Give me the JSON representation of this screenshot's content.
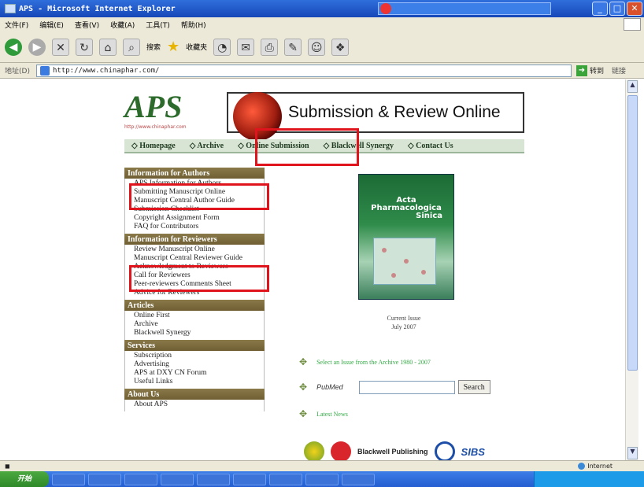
{
  "window": {
    "title": "APS - Microsoft Internet Explorer"
  },
  "menubar": {
    "items": [
      "文件(F)",
      "编辑(E)",
      "查看(V)",
      "收藏(A)",
      "工具(T)",
      "帮助(H)"
    ]
  },
  "toolbar": {
    "search_label": "搜索",
    "favorites_label": "收藏夹"
  },
  "addressbar": {
    "label": "地址(D)",
    "url": "http://www.chinaphar.com/",
    "go_label": "转到",
    "links_label": "链接"
  },
  "header": {
    "logo": "APS",
    "logo_url": "http://www.chinaphar.com",
    "banner": "Submission & Review Online"
  },
  "nav": {
    "items": [
      "◇ Homepage",
      "◇ Archive",
      "◇ Online Submission",
      "◇ Blackwell Synergy",
      "◇ Contact Us"
    ]
  },
  "sidebar": {
    "authors": {
      "heading": "Information for Authors",
      "items": [
        "APS Information for Authors",
        "Submitting Manuscript Online",
        "Manuscript Central Author Guide",
        "Submission Checklist",
        "Copyright Assignment Form",
        "FAQ for Contributors"
      ]
    },
    "reviewers": {
      "heading": "Information for Reviewers",
      "items": [
        "Review Manuscript Online",
        "Manuscript Central Reviewer Guide",
        "Acknowledgment to Reviewers",
        "Call for Reviewers",
        "Peer-reviewers Comments Sheet",
        "Advice for Reviewers"
      ]
    },
    "articles": {
      "heading": "Articles",
      "items": [
        "Online First",
        "Archive",
        "Blackwell Synergy"
      ]
    },
    "services": {
      "heading": "Services",
      "items": [
        "Subscription",
        "Advertising",
        "APS at DXY CN Forum",
        "Useful Links"
      ]
    },
    "about": {
      "heading": "About Us",
      "items": [
        "About APS"
      ]
    }
  },
  "cover": {
    "title_line1": "Acta",
    "title_line2": "Pharmacologica",
    "title_line3": "Sinica"
  },
  "current_issue": {
    "line1": "Current Issue",
    "line2": "July 2007"
  },
  "links": {
    "archive_select": "Select an Issue from the Archive 1980 - 2007",
    "pubmed": "PubMed",
    "search_button": "Search",
    "latest_news": "Latest News"
  },
  "sponsors": {
    "blackwell": "Blackwell Publishing",
    "sibs": "SIBS"
  },
  "status": {
    "zone": "Internet"
  },
  "taskbar": {
    "start": "开始"
  },
  "colors": {
    "highlight": "#e0141c",
    "sidebar_heading": "#6e5e32",
    "logo_green": "#2c6b2c"
  }
}
